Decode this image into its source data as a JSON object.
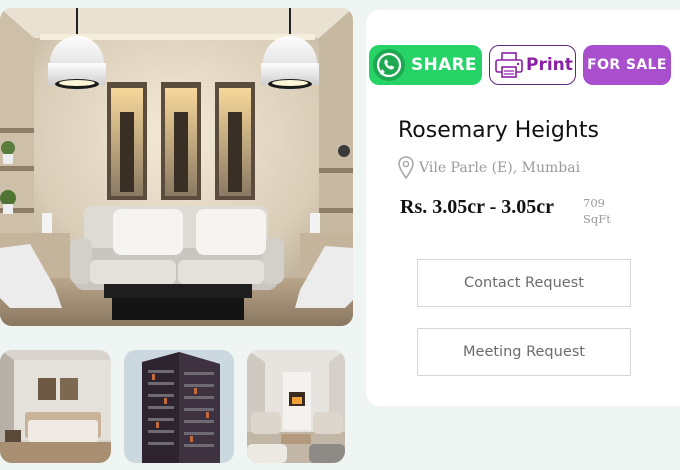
{
  "listing": {
    "title": "Rosemary Heights",
    "location": "Vile Parle (E), Mumbai",
    "price": "Rs. 3.05cr - 3.05cr",
    "area_value": "709",
    "area_unit": "SqFt",
    "status_badge": "FOR SALE"
  },
  "actions": {
    "share_label": "SHARE",
    "print_label": "Print",
    "contact_label": "Contact Request",
    "meeting_label": "Meeting Request"
  },
  "colors": {
    "share_green": "#25d366",
    "print_purple": "#8b1fa6",
    "sale_purple": "#a94fce",
    "page_bg": "#eef5f3"
  },
  "icons": {
    "share": "whatsapp-icon",
    "print": "printer-icon",
    "location": "map-pin-icon"
  }
}
